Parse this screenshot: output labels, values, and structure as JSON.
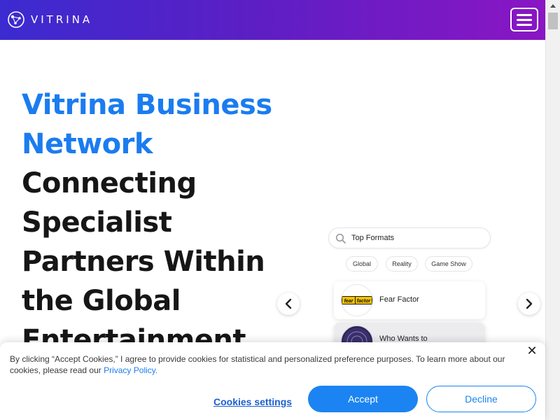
{
  "header": {
    "logo_text": "VITRINA",
    "logo_icon": "vitrina-globe-logo-icon",
    "menu_icon": "hamburger-menu-icon",
    "gradient_start": "#3b2bd0",
    "gradient_end": "#8a16c4"
  },
  "hero": {
    "title_highlight_lines": [
      "Vitrina Business",
      "Network"
    ],
    "title_lines": [
      "Connecting",
      "Specialist",
      "Partners Within",
      "the Global",
      "Entertainment"
    ],
    "highlight_color": "#1b7cf0"
  },
  "showcase": {
    "search_text": "Top Formats",
    "search_icon": "search-icon",
    "chips": [
      "Global",
      "Reality",
      "Game Show"
    ],
    "cards": [
      {
        "title": "Fear Factor",
        "thumb_text": "fear factor"
      },
      {
        "title": "Who Wants to",
        "thumb_text": ""
      }
    ],
    "prev_icon": "chevron-left-icon",
    "next_icon": "chevron-right-icon"
  },
  "cookie_banner": {
    "text": "By clicking “Accept Cookies,” I agree to provide cookies for statistical and personalized preference purposes. To learn more about our cookies, please read our ",
    "link_text": "Privacy Policy.",
    "settings_label": "Cookies settings",
    "accept_label": "Accept",
    "decline_label": "Decline",
    "close_icon": "close-icon",
    "accent_color": "#1b84f2"
  }
}
